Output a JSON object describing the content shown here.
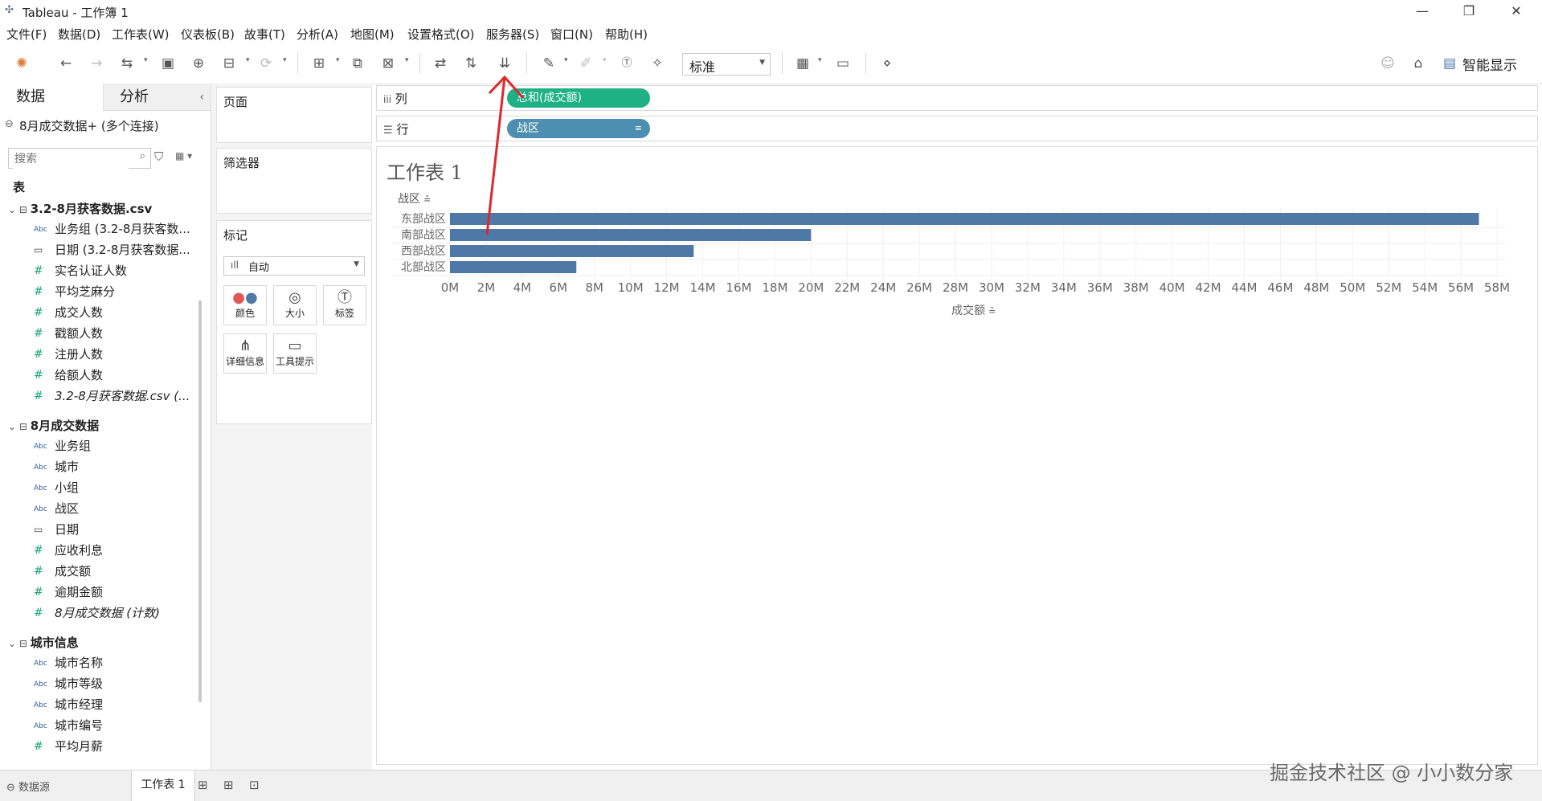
{
  "window": {
    "app_icon": "tableau-icon",
    "title": "Tableau - 工作簿 1",
    "min": "—",
    "restore": "❐",
    "close": "✕"
  },
  "menu": [
    "文件(F)",
    "数据(D)",
    "工作表(W)",
    "仪表板(B)",
    "故事(T)",
    "分析(A)",
    "地图(M)",
    "设置格式(O)",
    "服务器(S)",
    "窗口(N)",
    "帮助(H)"
  ],
  "toolbar": {
    "fit_select": "标准",
    "smart_show": "智能显示"
  },
  "data_pane": {
    "tab_data": "数据",
    "tab_analysis": "分析",
    "datasource": "8月成交数据+ (多个连接)",
    "search_placeholder": "搜索",
    "tables_label": "表",
    "groups": [
      {
        "name": "3.2-8月获客数据.csv",
        "fields": [
          {
            "type": "Abc",
            "name": "业务组 (3.2-8月获客数..."
          },
          {
            "type": "date",
            "name": "日期 (3.2-8月获客数据..."
          },
          {
            "type": "#",
            "name": "实名认证人数"
          },
          {
            "type": "#",
            "name": "平均芝麻分"
          },
          {
            "type": "#",
            "name": "成交人数"
          },
          {
            "type": "#",
            "name": "戳额人数"
          },
          {
            "type": "#",
            "name": "注册人数"
          },
          {
            "type": "#",
            "name": "给额人数"
          },
          {
            "type": "#",
            "name": "3.2-8月获客数据.csv (..."
          }
        ]
      },
      {
        "name": "8月成交数据",
        "fields": [
          {
            "type": "Abc",
            "name": "业务组"
          },
          {
            "type": "Abc",
            "name": "城市"
          },
          {
            "type": "Abc",
            "name": "小组"
          },
          {
            "type": "Abc",
            "name": "战区"
          },
          {
            "type": "date",
            "name": "日期"
          },
          {
            "type": "#",
            "name": "应收利息"
          },
          {
            "type": "#",
            "name": "成交额"
          },
          {
            "type": "#",
            "name": "逾期金额"
          },
          {
            "type": "#",
            "name": "8月成交数据 (计数)"
          }
        ]
      },
      {
        "name": "城市信息",
        "fields": [
          {
            "type": "Abc",
            "name": "城市名称"
          },
          {
            "type": "Abc",
            "name": "城市等级"
          },
          {
            "type": "Abc",
            "name": "城市经理"
          },
          {
            "type": "Abc",
            "name": "城市编号"
          },
          {
            "type": "#",
            "name": "平均月薪"
          }
        ]
      }
    ]
  },
  "cards": {
    "pages": "页面",
    "filters": "筛选器",
    "marks": "标记",
    "mark_type": "自动",
    "mark_buttons": [
      "颜色",
      "大小",
      "标签",
      "详细信息",
      "工具提示"
    ]
  },
  "shelves": {
    "columns_label": "列",
    "rows_label": "行",
    "columns_pill": "总和(成交额)",
    "rows_pill": "战区",
    "columns_color": "#1db184",
    "rows_color": "#4d8fb0"
  },
  "sheet": {
    "title": "工作表 1"
  },
  "chart_data": {
    "type": "bar",
    "orientation": "horizontal",
    "row_header": "战区",
    "categories": [
      "东部战区",
      "南部战区",
      "西部战区",
      "北部战区"
    ],
    "values": [
      57000000,
      20000000,
      13500000,
      7000000
    ],
    "xlabel": "成交额",
    "xlim": [
      0,
      58000000
    ],
    "ticks": [
      "0M",
      "2M",
      "4M",
      "6M",
      "8M",
      "10M",
      "12M",
      "14M",
      "16M",
      "18M",
      "20M",
      "22M",
      "24M",
      "26M",
      "28M",
      "30M",
      "32M",
      "34M",
      "36M",
      "38M",
      "40M",
      "42M",
      "44M",
      "46M",
      "48M",
      "50M",
      "52M",
      "54M",
      "56M",
      "58M"
    ],
    "bar_color": "#4e79a7",
    "grid": true
  },
  "bottom": {
    "datasource_tab": "数据源",
    "sheet_tab": "工作表 1"
  },
  "watermark": "掘金技术社区 @ 小小数分家",
  "annotation_color": "#e0262e"
}
